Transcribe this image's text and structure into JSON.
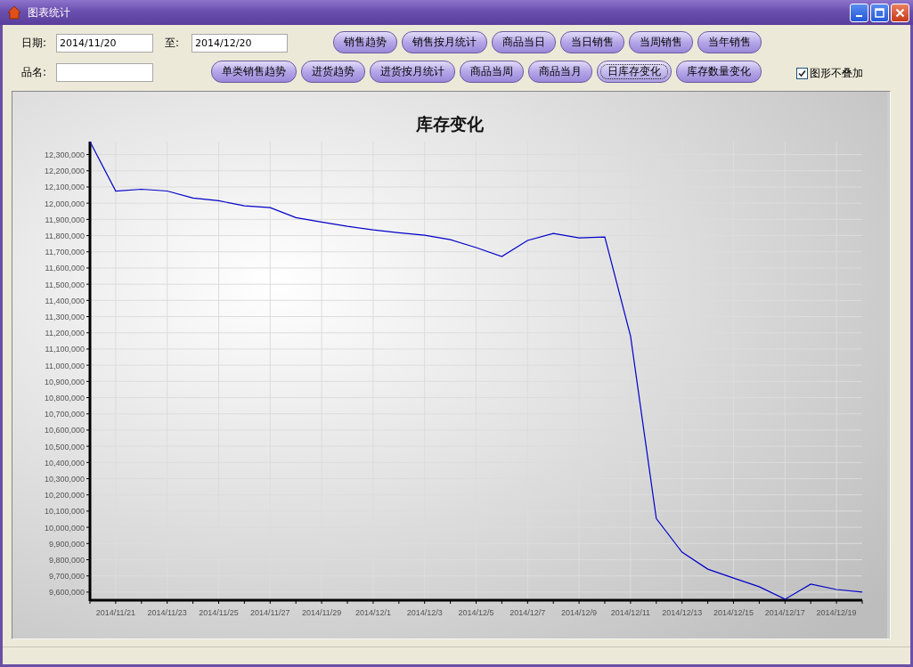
{
  "window": {
    "title": "图表统计"
  },
  "filters": {
    "date_label": "日期:",
    "date_from": "2014/11/20",
    "to_label": "至:",
    "date_to": "2014/12/20",
    "name_label": "品名:"
  },
  "button_rows": [
    [
      {
        "label": "销售趋势",
        "selected": false
      },
      {
        "label": "销售按月统计",
        "selected": false
      },
      {
        "label": "商品当日",
        "selected": false
      },
      {
        "label": "当日销售",
        "selected": false
      },
      {
        "label": "当周销售",
        "selected": false
      },
      {
        "label": "当年销售",
        "selected": false
      }
    ],
    [
      {
        "label": "单类销售趋势",
        "selected": false
      },
      {
        "label": "进货趋势",
        "selected": false
      },
      {
        "label": "进货按月统计",
        "selected": false
      },
      {
        "label": "商品当周",
        "selected": false
      },
      {
        "label": "商品当月",
        "selected": false
      },
      {
        "label": "日库存变化",
        "selected": true
      },
      {
        "label": "库存数量变化",
        "selected": false
      }
    ]
  ],
  "overlay_option": {
    "label": "图形不叠加",
    "checked": true
  },
  "chart_data": {
    "type": "line",
    "title": "库存变化",
    "categories": [
      null,
      "2014/11/21",
      null,
      "2014/11/23",
      null,
      "2014/11/25",
      null,
      "2014/11/27",
      null,
      "2014/11/29",
      null,
      "2014/12/1",
      null,
      "2014/12/3",
      null,
      "2014/12/5",
      null,
      "2014/12/7",
      null,
      "2014/12/9",
      null,
      "2014/12/11",
      null,
      "2014/12/13",
      null,
      "2014/12/15",
      null,
      "2014/12/17",
      null,
      "2014/12/19",
      null
    ],
    "series": [
      {
        "color": "#0000c8",
        "values": [
          12380000,
          12075000,
          12086000,
          12075000,
          12032000,
          12015000,
          11983000,
          11972000,
          11911000,
          11884000,
          11857000,
          11835000,
          11818000,
          11802000,
          11775000,
          11726000,
          11671000,
          11770000,
          11813000,
          11786000,
          11791000,
          11180000,
          10054000,
          9846000,
          9742000,
          9687000,
          9633000,
          9556000,
          9649000,
          9616000,
          9600000
        ]
      }
    ],
    "ylim": [
      9550000,
      12380000
    ],
    "grid": true,
    "yticks": [
      {
        "value": 9600000,
        "label": "9,600,000"
      },
      {
        "value": 9700000,
        "label": "9,700,000"
      },
      {
        "value": 9800000,
        "label": "9,800,000"
      },
      {
        "value": 9900000,
        "label": "9,900,000"
      },
      {
        "value": 10000000,
        "label": "10,000,000"
      },
      {
        "value": 10100000,
        "label": "10,100,000"
      },
      {
        "value": 10200000,
        "label": "10,200,000"
      },
      {
        "value": 10300000,
        "label": "10,300,000"
      },
      {
        "value": 10400000,
        "label": "10,400,000"
      },
      {
        "value": 10500000,
        "label": "10,500,000"
      },
      {
        "value": 10600000,
        "label": "10,600,000"
      },
      {
        "value": 10700000,
        "label": "10,700,000"
      },
      {
        "value": 10800000,
        "label": "10,800,000"
      },
      {
        "value": 10900000,
        "label": "10,900,000"
      },
      {
        "value": 11000000,
        "label": "11,000,000"
      },
      {
        "value": 11100000,
        "label": "11,100,000"
      },
      {
        "value": 11200000,
        "label": "11,200,000"
      },
      {
        "value": 11300000,
        "label": "11,300,000"
      },
      {
        "value": 11400000,
        "label": "11,400,000"
      },
      {
        "value": 11500000,
        "label": "11,500,000"
      },
      {
        "value": 11600000,
        "label": "11,600,000"
      },
      {
        "value": 11700000,
        "label": "11,700,000"
      },
      {
        "value": 11800000,
        "label": "11,800,000"
      },
      {
        "value": 11900000,
        "label": "11,900,000"
      },
      {
        "value": 12000000,
        "label": "12,000,000"
      },
      {
        "value": 12100000,
        "label": "12,100,000"
      },
      {
        "value": 12200000,
        "label": "12,200,000"
      },
      {
        "value": 12300000,
        "label": "12,300,000"
      }
    ]
  }
}
